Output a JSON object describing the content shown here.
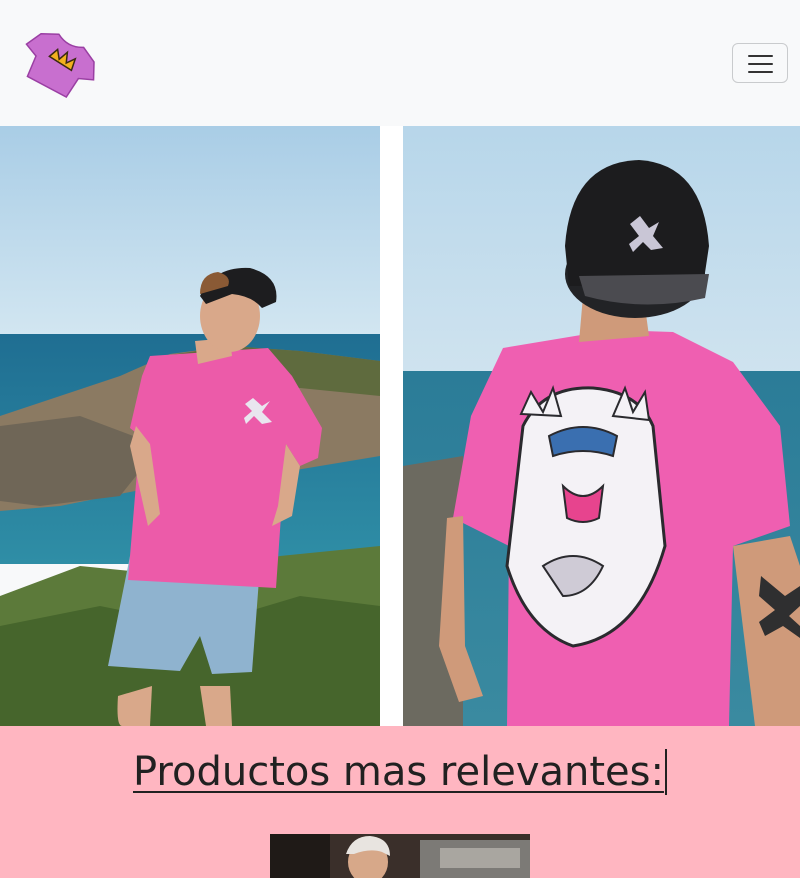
{
  "navbar": {
    "logo_icon": "crown-tshirt-logo",
    "toggler_icon": "hamburger-menu-icon",
    "colors": {
      "background": "#f8f9fa",
      "border": "#c9cbcd"
    }
  },
  "hero": {
    "images": [
      {
        "name": "model-pink-tshirt-front-photo"
      },
      {
        "name": "model-pink-tshirt-back-photo"
      }
    ]
  },
  "products": {
    "title": "Productos mas relevantes:",
    "background": "#ffb6c1",
    "thumbnail": "product-photo"
  }
}
